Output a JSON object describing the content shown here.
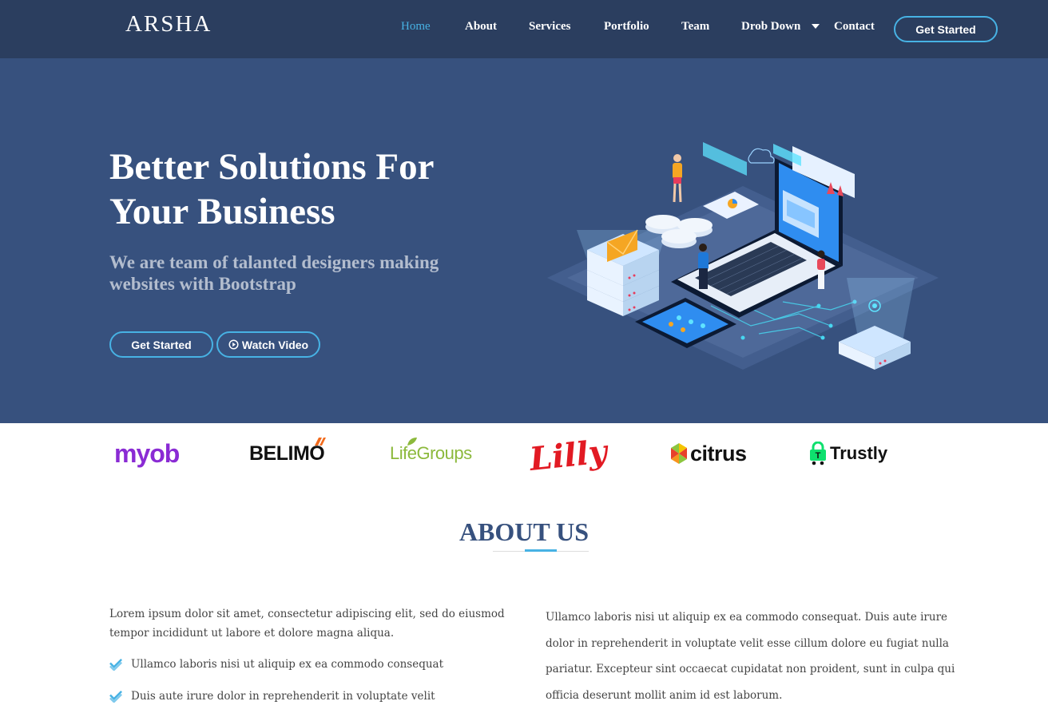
{
  "header": {
    "logo": "ARSHA",
    "nav": [
      "Home",
      "About",
      "Services",
      "Portfolio",
      "Team",
      "Drob Down",
      "Contact"
    ],
    "active_item": "Home",
    "cta": "Get Started"
  },
  "hero": {
    "title": "Better Solutions For Your Business",
    "subtitle": "We are team of talanted designers making websites with Bootstrap",
    "btn_start": "Get Started",
    "btn_video": "Watch Video"
  },
  "clients": [
    "myob",
    "BELIMO",
    "LifeGroups",
    "Lilly",
    "citrus",
    "Trustly"
  ],
  "about": {
    "title": "ABOUT US",
    "intro": "Lorem ipsum dolor sit amet, consectetur adipiscing elit, sed do eiusmod tempor incididunt ut labore et dolore magna aliqua.",
    "checks": [
      "Ullamco laboris nisi ut aliquip ex ea commodo consequat",
      "Duis aute irure dolor in reprehenderit in voluptate velit"
    ],
    "right_text": "Ullamco laboris nisi ut aliquip ex ea commodo consequat. Duis aute irure dolor in reprehenderit in voluptate velit esse cillum dolore eu fugiat nulla pariatur. Excepteur sint occaecat cupidatat non proident, sunt in culpa qui officia deserunt mollit anim id est laborum."
  },
  "colors": {
    "header_bg": "#2b3e5f",
    "hero_bg": "#37517e",
    "accent": "#47b2e4",
    "heading": "#37517e"
  }
}
